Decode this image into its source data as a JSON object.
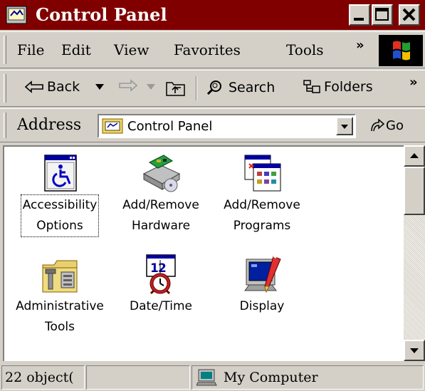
{
  "window": {
    "title": "Control Panel"
  },
  "menu": {
    "items": [
      "File",
      "Edit",
      "View",
      "Favorites",
      "Tools"
    ],
    "more": "»"
  },
  "toolbar": {
    "back": "Back",
    "search": "Search",
    "folders": "Folders",
    "more": "»"
  },
  "address": {
    "label": "Address",
    "value": "Control Panel",
    "go": "Go"
  },
  "items": [
    {
      "label": "Accessibility\nOptions",
      "icon": "accessibility-options-icon"
    },
    {
      "label": "Add/Remove\nHardware",
      "icon": "add-remove-hardware-icon"
    },
    {
      "label": "Add/Remove\nPrograms",
      "icon": "add-remove-programs-icon"
    },
    {
      "label": "Administrative\nTools",
      "icon": "administrative-tools-icon"
    },
    {
      "label": "Date/Time",
      "icon": "date-time-icon"
    },
    {
      "label": "Display",
      "icon": "display-icon"
    }
  ],
  "status": {
    "objects": "22 object(",
    "zone": "My Computer"
  },
  "colors": {
    "titlebar": "#800000",
    "face": "#d4d0c8",
    "content": "#ffffff"
  }
}
